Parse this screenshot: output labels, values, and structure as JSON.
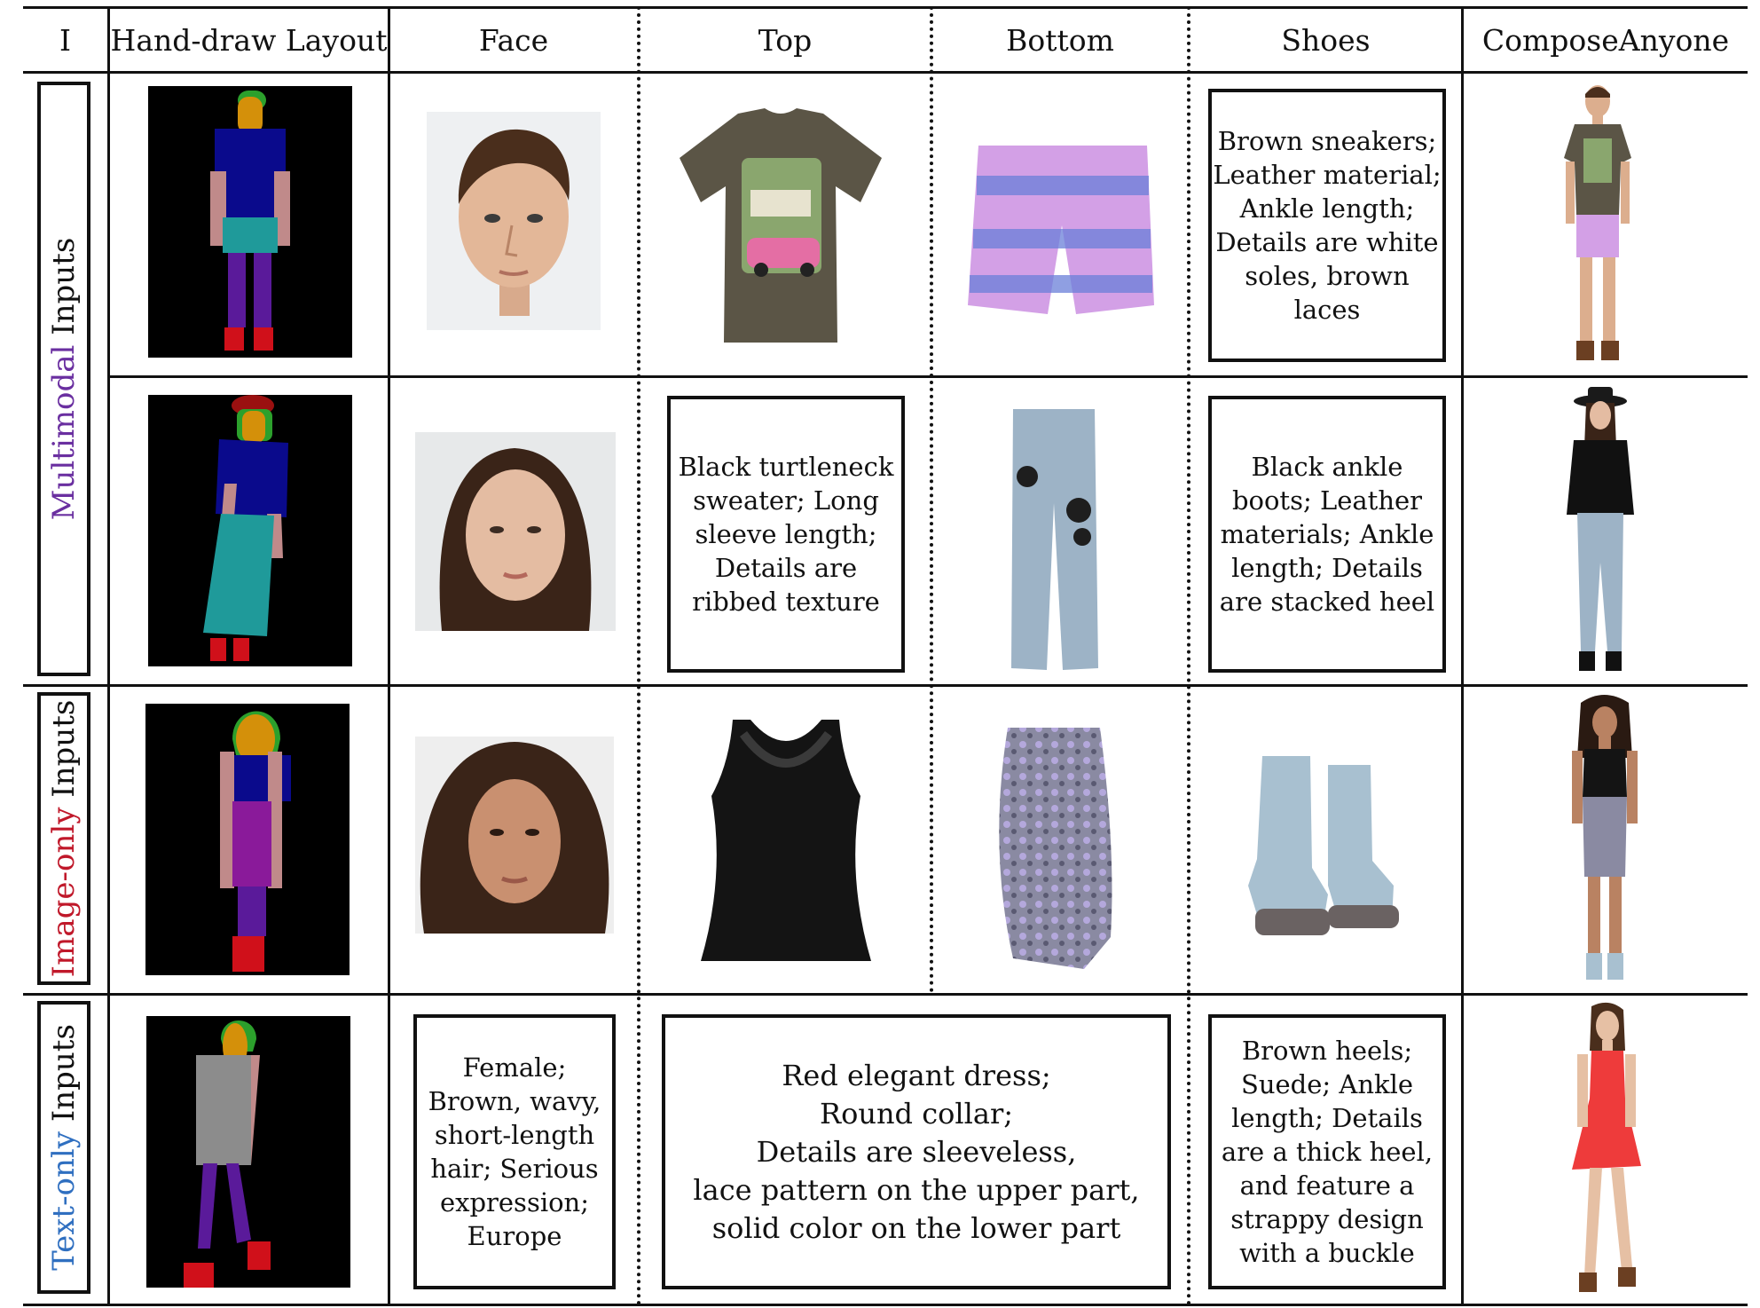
{
  "header": {
    "col_index": "I",
    "col_layout": "Hand-draw Layout",
    "col_face": "Face",
    "col_top": "Top",
    "col_bottom": "Bottom",
    "col_shoes": "Shoes",
    "col_result": "ComposeAnyone"
  },
  "row_labels": {
    "multimodal_colored": "Multimodal",
    "multimodal_rest": " Inputs",
    "image_only_colored": "Image-only",
    "image_only_rest": " Inputs",
    "text_only_colored": "Text-only",
    "text_only_rest": " Inputs"
  },
  "label_colors": {
    "multimodal": "#6a2fa0",
    "image_only": "#c0182a",
    "text_only": "#2f6fc0"
  },
  "texts": {
    "row1_shoes": "Brown sneakers;\nLeather material;\nAnkle length;\nDetails are white\nsoles, brown\nlaces",
    "row2_top": "Black turtleneck\nsweater; Long\nsleeve length;\nDetails are\nribbed texture",
    "row2_shoes": "Black ankle\nboots;  Leather\nmaterials; Ankle\nlength; Details\nare stacked heel",
    "row4_face": "Female;\nBrown, wavy,\nshort-length\nhair; Serious\nexpression;\nEurope",
    "row4_top_bottom": "Red elegant dress;\nRound collar;\nDetails are sleeveless,\nlace pattern on the upper part,\nsolid color on the lower part",
    "row4_shoes": "Brown heels;\nSuede; Ankle\nlength; Details\nare a thick heel,\nand feature a\nstrappy design\nwith a buckle"
  },
  "layout_colors": {
    "hair": "#2ca02c",
    "face": "#d4900a",
    "upper": "#0a0a8c",
    "arms": "#c08a8a",
    "skirt_teal": "#1f9a9a",
    "legs": "#5a1a9a",
    "shoes": "#d0101a",
    "hat": "#9a1010",
    "gray_dress": "#8c8c8c",
    "magenta_skirt": "#8a1a9a"
  },
  "icons": {
    "row1_face": "male-face-photo",
    "row1_top": "olive-graphic-tshirt-photo",
    "row1_bottom": "lilac-patterned-shorts-photo",
    "row1_result": "man-in-tshirt-and-shorts-photo",
    "row2_face": "female-face-photo",
    "row2_bottom": "floral-jeans-photo",
    "row2_result": "woman-in-hat-and-jeans-photo",
    "row3_face": "curly-hair-female-face-photo",
    "row3_top": "black-lace-tank-top-photo",
    "row3_bottom": "floral-ruched-skirt-photo",
    "row3_shoes": "denim-boots-photo",
    "row3_result": "woman-in-tank-and-skirt-photo",
    "row4_result": "woman-in-red-dress-photo"
  }
}
